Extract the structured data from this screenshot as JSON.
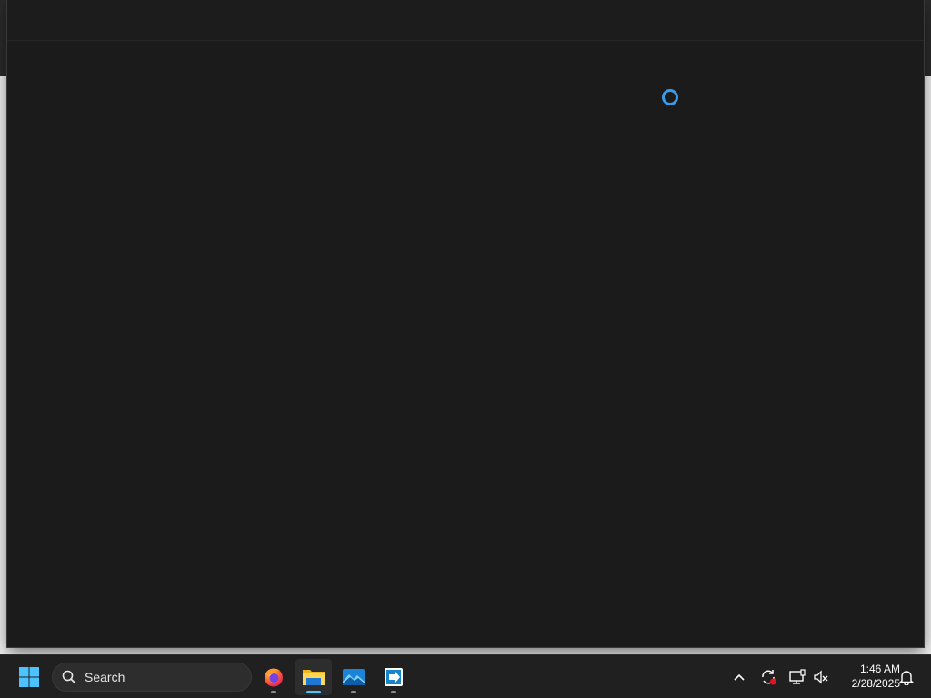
{
  "loading_indicator": "spinner",
  "taskbar": {
    "start_icon": "windows-start-icon",
    "search": {
      "label": "Search",
      "icon": "search-icon"
    },
    "pinned_apps": [
      {
        "name": "firefox",
        "icon": "firefox-icon",
        "running": true,
        "active": false
      },
      {
        "name": "file-explorer",
        "icon": "folder-icon",
        "running": true,
        "active": true
      },
      {
        "name": "photos",
        "icon": "photos-icon",
        "running": true,
        "active": false
      },
      {
        "name": "remote-app",
        "icon": "remote-arrow-icon",
        "running": true,
        "active": false
      }
    ],
    "tray": {
      "chevron_icon": "chevron-up-icon",
      "icons": [
        "sync-alert-icon",
        "network-icon",
        "volume-muted-icon"
      ],
      "time": "1:46 AM",
      "date": "2/28/2025",
      "notification_icon": "bell-icon"
    }
  },
  "colors": {
    "accent": "#4cc2ff",
    "spinner": "#3a9be8",
    "window_bg": "#1b1b1b",
    "taskbar_bg": "#202020"
  }
}
